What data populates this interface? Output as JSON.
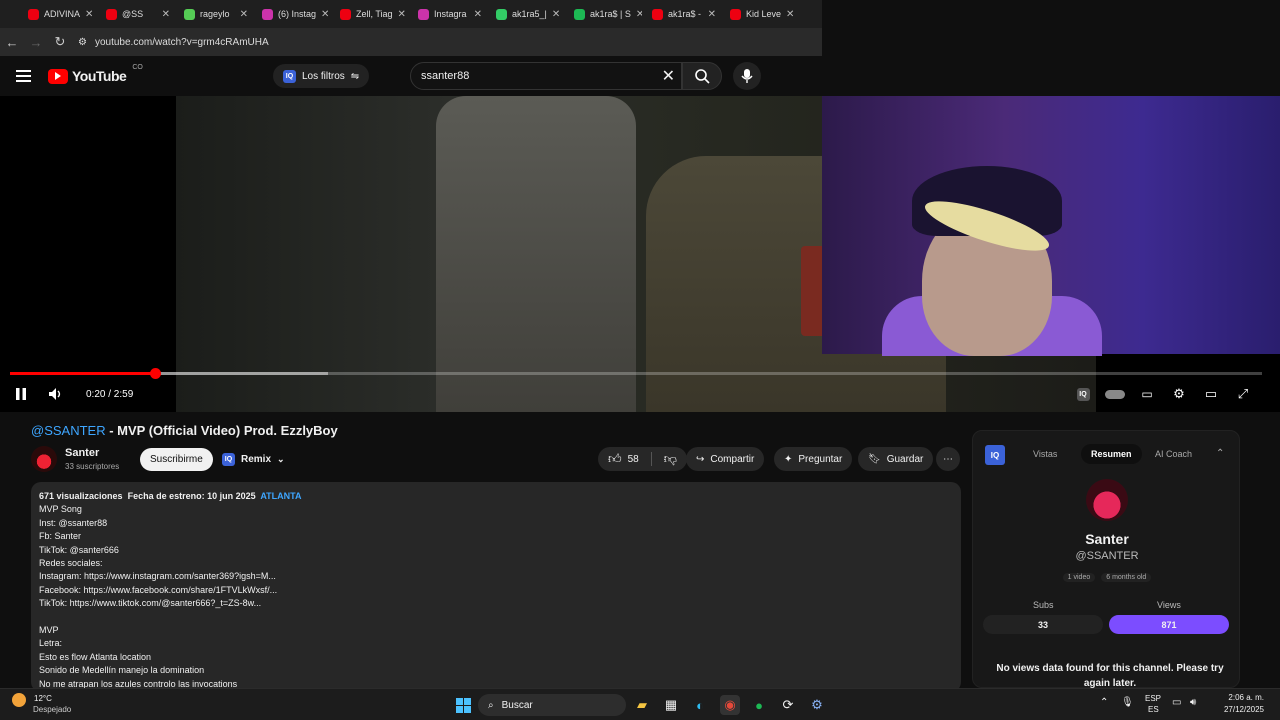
{
  "browser": {
    "tabs": [
      {
        "label": "ADIVINA",
        "color": "#e01"
      },
      {
        "label": "@SS",
        "color": "#e01"
      },
      {
        "label": "rageylo",
        "color": "#5c5"
      },
      {
        "label": "(6) Instag",
        "color": "#c3a"
      },
      {
        "label": "Zell, Tiag",
        "color": "#e01"
      },
      {
        "label": "Instagra",
        "color": "#c3a"
      },
      {
        "label": "ak1ra5_|",
        "color": "#3c6"
      },
      {
        "label": "ak1ra$ | S",
        "color": "#1db954"
      },
      {
        "label": "ak1ra$ -",
        "color": "#e01"
      },
      {
        "label": "Kid Leve",
        "color": "#e01"
      }
    ],
    "url": "youtube.com/watch?v=grm4cRAmUHA"
  },
  "youtube": {
    "logo_text": "YouTube",
    "country": "CO",
    "filters_label": "Los filtros",
    "search_value": "ssanter88"
  },
  "player": {
    "time": "0:20 / 2:59",
    "played_fraction": 0.116,
    "buffered_fraction": 0.254
  },
  "video": {
    "title_handle": "@SSANTER",
    "title_rest": " - MVP (Official Video) Prod. EzzlyBoy",
    "channel": "Santer",
    "subscribers": "33 suscriptores",
    "subscribe_label": "Suscribirme",
    "remix_label": "Remix",
    "likes": "58",
    "share_label": "Compartir",
    "ask_label": "Preguntar",
    "save_label": "Guardar"
  },
  "description": {
    "views": "671 visualizaciones",
    "date": "Fecha de estreno: 10 jun 2025",
    "hashtag": "ATLANTA",
    "lines": [
      "MVP Song",
      "Inst: @ssanter88",
      "Fb: Santer",
      "TikTok: @santer666",
      "Redes sociales:",
      "Instagram: https://www.instagram.com/santer369?igsh=M...",
      "Facebook: https://www.facebook.com/share/1FTVLkWxsf/...",
      "TikTok: https://www.tiktok.com/@santer666?_t=ZS-8w...",
      "",
      "MVP",
      "Letra:",
      "Esto es flow Atlanta location",
      "Sonido de Medellín manejo la domination",
      "No me atrapan los azules controlo las invocations"
    ]
  },
  "panel": {
    "tabs": [
      "Vistas",
      "Resumen",
      "AI Coach"
    ],
    "active_tab": "Resumen",
    "name": "Santer",
    "handle": "@SSANTER",
    "chips": [
      "1 video",
      "6 months old"
    ],
    "subs_label": "Subs",
    "subs_value": "33",
    "views_label": "Views",
    "views_value": "871",
    "accent": "#7c4dff",
    "no_data": "No views data found for this channel. Please try again later."
  },
  "taskbar": {
    "temp": "12°C",
    "weather": "Despejado",
    "search": "Buscar",
    "lang1": "ESP",
    "lang2": "ES",
    "time": "2:06 a. m.",
    "date": "27/12/2025"
  }
}
